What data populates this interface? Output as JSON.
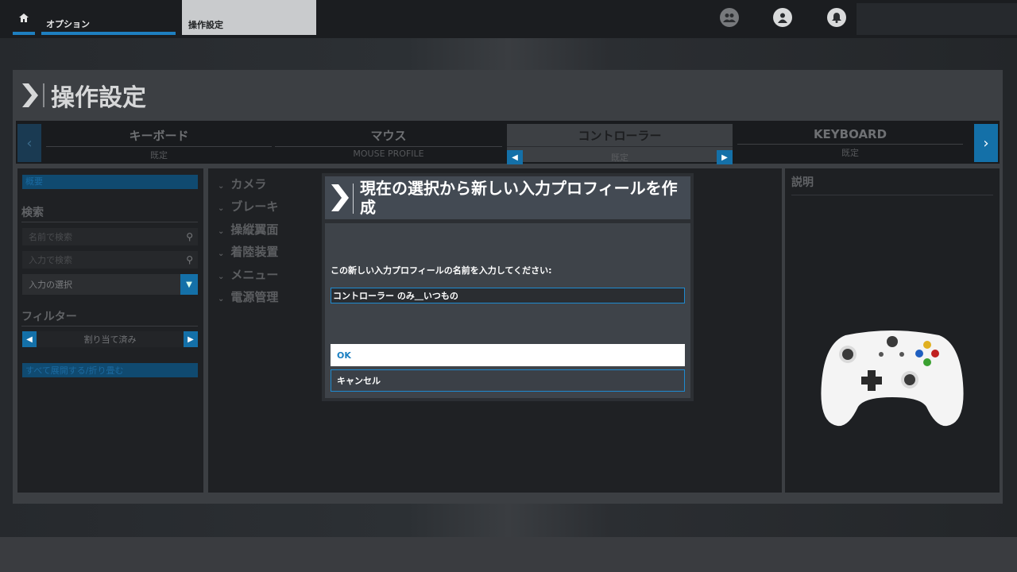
{
  "topbar": {
    "tabs": [
      {
        "label": "オプション"
      },
      {
        "label": "操作設定"
      }
    ],
    "icons": [
      "home-icon",
      "group-icon",
      "user-icon",
      "bell-icon"
    ]
  },
  "page": {
    "title": "操作設定"
  },
  "device_tabs": [
    {
      "title": "キーボード",
      "sub": "既定"
    },
    {
      "title": "マウス",
      "sub": "MOUSE PROFILE"
    },
    {
      "title": "コントローラー",
      "sub": "既定"
    },
    {
      "title": "KEYBOARD",
      "sub": "既定"
    }
  ],
  "sidebar": {
    "category_label": "概要",
    "search_title": "検索",
    "search_name_placeholder": "名前で検索",
    "search_input_placeholder": "入力で検索",
    "input_select_label": "入力の選択",
    "filter_title": "フィルター",
    "filter_value": "割り当て済み",
    "expand_label": "すべて展開する/折り畳む"
  },
  "categories": [
    "カメラ",
    "ブレーキ",
    "操縦翼面",
    "着陸装置",
    "メニュー",
    "電源管理"
  ],
  "description": {
    "title": "説明"
  },
  "modal": {
    "title": "現在の選択から新しい入力プロフィールを作成",
    "prompt": "この新しい入力プロフィールの名前を入力してください:",
    "input_value": "コントローラー のみ＿いつもの",
    "ok_label": "OK",
    "cancel_label": "キャンセル"
  },
  "colors": {
    "accent": "#1e8ad0",
    "ok_text": "#1a7fc2"
  }
}
